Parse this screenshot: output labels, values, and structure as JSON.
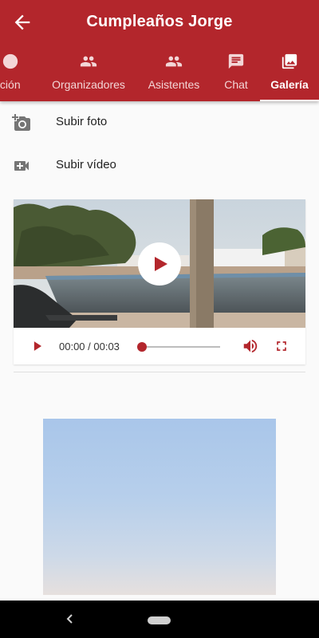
{
  "header": {
    "title": "Cumpleaños Jorge",
    "back_icon": "arrow-left-icon",
    "background_color": "#b3262c"
  },
  "tabs": [
    {
      "label": "nación",
      "icon": "circle-icon",
      "active": false
    },
    {
      "label": "Organizadores",
      "icon": "people-icon",
      "active": false
    },
    {
      "label": "Asistentes",
      "icon": "people-icon",
      "active": false
    },
    {
      "label": "Chat",
      "icon": "chat-icon",
      "active": false
    },
    {
      "label": "Galería",
      "icon": "gallery-icon",
      "active": true
    }
  ],
  "actions": {
    "upload_photo": {
      "label": "Subir foto",
      "icon": "add-a-photo-icon"
    },
    "upload_video": {
      "label": "Subir vídeo",
      "icon": "video-call-icon"
    }
  },
  "video_player": {
    "time": "00:00 / 00:03",
    "progress": 0,
    "accent_color": "#b3262c"
  }
}
